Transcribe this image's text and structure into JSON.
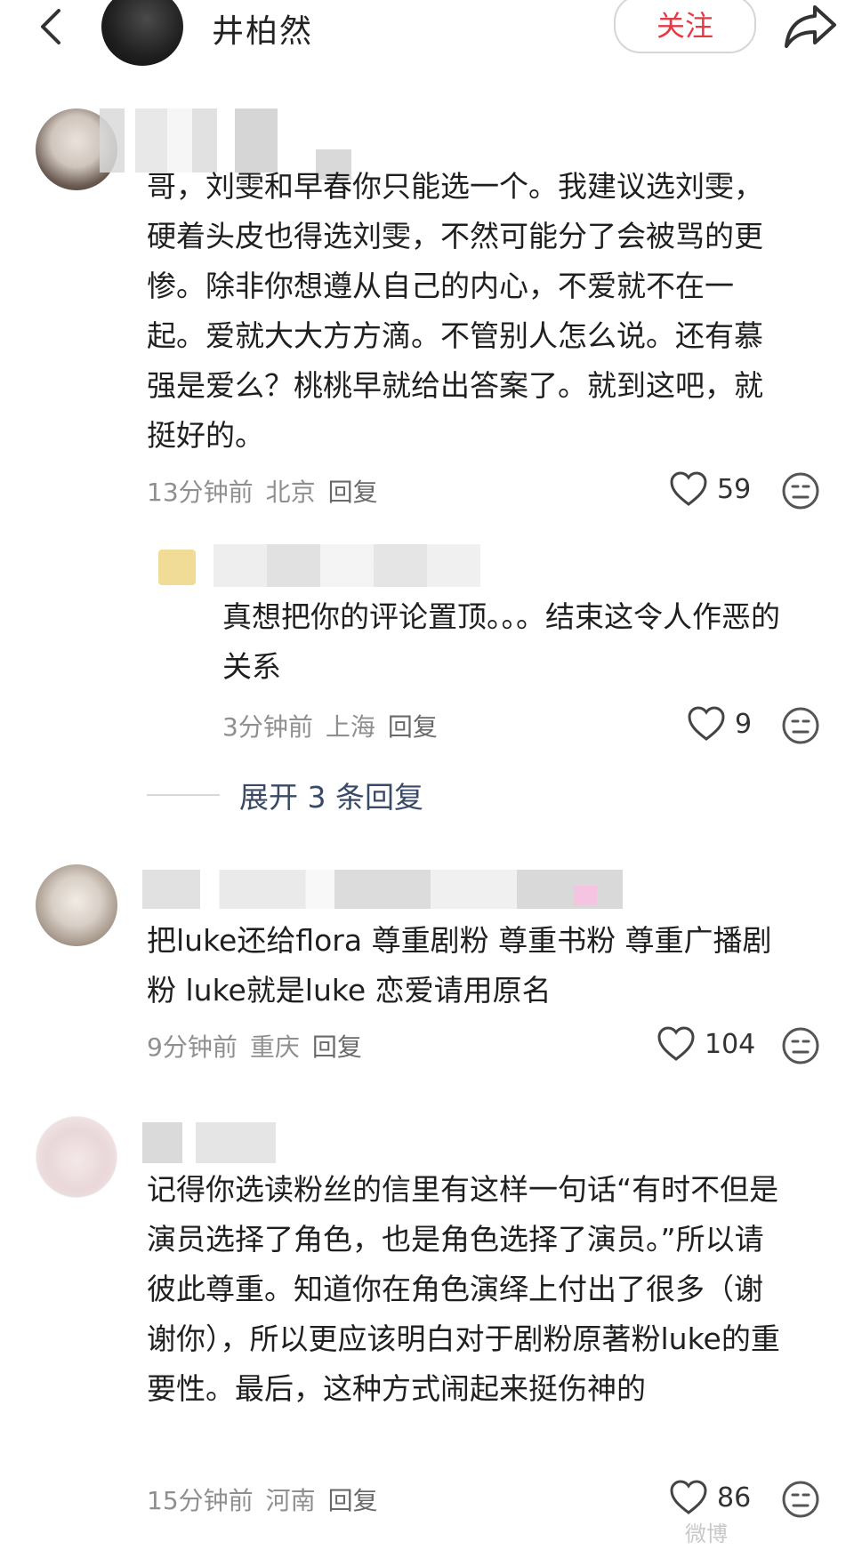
{
  "header": {
    "title": "井柏然",
    "follow_label": "关注",
    "icons": [
      "back-arrow-icon",
      "share-icon"
    ]
  },
  "comments": [
    {
      "text": "哥，刘雯和早春你只能选一个。我建议选刘雯，硬着头皮也得选刘雯，不然可能分了会被骂的更惨。除非你想遵从自己的内心，不爱就不在一起。爱就大大方方滴。不管别人怎么说。还有慕强是爱么？桃桃早就给出答案了。就到这吧，就挺好的。",
      "time": "13分钟前",
      "location": "北京",
      "reply": "回复",
      "likes": "59"
    },
    {
      "text": "把luke还给flora   尊重剧粉 尊重书粉 尊重广播剧粉 luke就是luke  恋爱请用原名",
      "time": "9分钟前",
      "location": "重庆",
      "reply": "回复",
      "likes": "104"
    },
    {
      "text": "记得你选读粉丝的信里有这样一句话“有时不但是演员选择了角色，也是角色选择了演员。”所以请彼此尊重。知道你在角色演绎上付出了很多（谢谢你），所以更应该明白对于剧粉原著粉luke的重要性。最后，这种方式闹起来挺伤神的",
      "time": "15分钟前",
      "location": "河南",
      "reply": "回复",
      "likes": "86"
    }
  ],
  "reply": {
    "text": "真想把你的评论置顶。。。结束这令人作恶的关系",
    "time": "3分钟前",
    "location": "上海",
    "reply": "回复",
    "likes": "9"
  },
  "expand_replies": "展开 3 条回复",
  "watermark": "微博"
}
